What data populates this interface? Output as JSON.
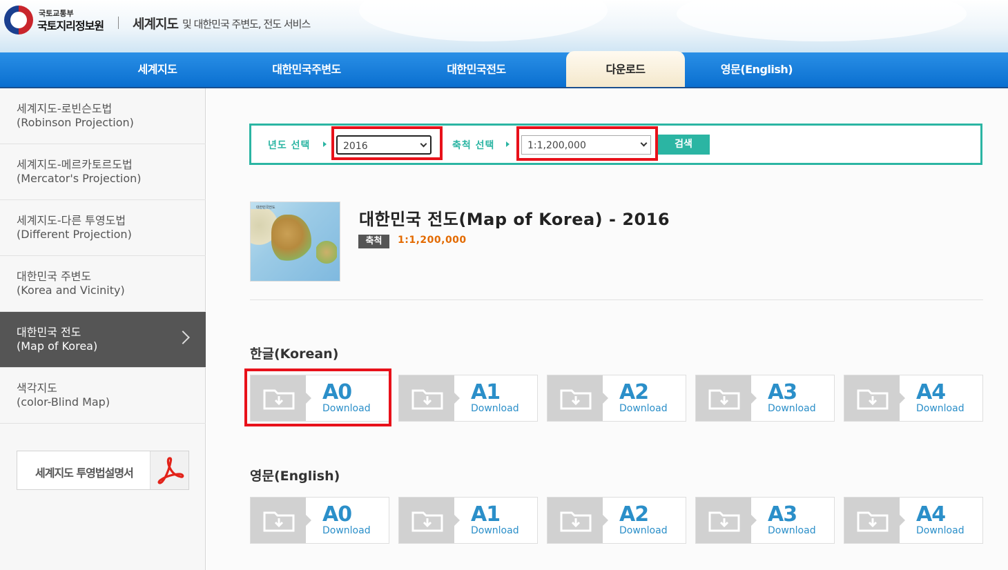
{
  "header": {
    "ministry": "국토교통부",
    "agency": "국토지리정보원",
    "title": "세계지도",
    "subtitle": "및 대한민국 주변도, 전도 서비스"
  },
  "nav": {
    "items": [
      {
        "label": "세계지도"
      },
      {
        "label": "대한민국주변도"
      },
      {
        "label": "대한민국전도"
      },
      {
        "label": "다운로드",
        "active": true
      },
      {
        "label": "영문(English)"
      }
    ]
  },
  "sidebar": {
    "items": [
      {
        "ko": "세계지도-로빈슨도법",
        "en": "(Robinson Projection)"
      },
      {
        "ko": "세계지도-메르카토르도법",
        "en": "(Mercator's Projection)"
      },
      {
        "ko": "세계지도-다른 투영도법",
        "en": "(Different Projection)"
      },
      {
        "ko": "대한민국 주변도",
        "en": "(Korea and Vicinity)"
      },
      {
        "ko": "대한민국 전도",
        "en": "(Map of Korea)",
        "active": true
      },
      {
        "ko": "색각지도",
        "en": "(color-Blind Map)"
      }
    ],
    "manual_label": "세계지도 투영법설명서",
    "manual_icon": "pdf-icon"
  },
  "search": {
    "year_label": "년도 선택",
    "year_value": "2016",
    "scale_label": "축척 선택",
    "scale_value": "1:1,200,000",
    "button_label": "검색",
    "accent_color": "#2bb5a3"
  },
  "map": {
    "thumb_title": "대한민국전도",
    "title": "대한민국 전도(Map of Korea) - 2016",
    "scale_badge": "축척",
    "scale_value": "1:1,200,000"
  },
  "downloads": {
    "korean": {
      "title": "한글(Korean)",
      "items": [
        {
          "size": "A0",
          "label": "Download"
        },
        {
          "size": "A1",
          "label": "Download"
        },
        {
          "size": "A2",
          "label": "Download"
        },
        {
          "size": "A3",
          "label": "Download"
        },
        {
          "size": "A4",
          "label": "Download"
        }
      ]
    },
    "english": {
      "title": "영문(English)",
      "items": [
        {
          "size": "A0",
          "label": "Download"
        },
        {
          "size": "A1",
          "label": "Download"
        },
        {
          "size": "A2",
          "label": "Download"
        },
        {
          "size": "A3",
          "label": "Download"
        },
        {
          "size": "A4",
          "label": "Download"
        }
      ]
    }
  },
  "colors": {
    "nav_blue": "#0a6fd0",
    "highlight_red": "#e8111a",
    "download_blue": "#2b8fc9",
    "scale_orange": "#e36a00"
  }
}
